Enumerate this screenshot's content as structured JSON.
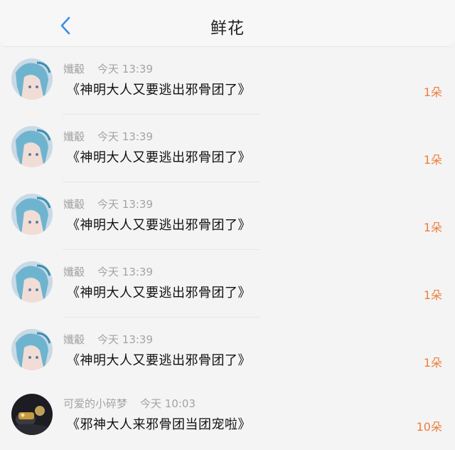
{
  "header": {
    "title": "鲜花"
  },
  "items": [
    {
      "user": "孅觳",
      "time": "今天 13:39",
      "message": "《神明大人又要逃出邪骨团了》",
      "count": "1朵",
      "avatar": "anime-girl"
    },
    {
      "user": "孅觳",
      "time": "今天 13:39",
      "message": "《神明大人又要逃出邪骨团了》",
      "count": "1朵",
      "avatar": "anime-girl"
    },
    {
      "user": "孅觳",
      "time": "今天 13:39",
      "message": "《神明大人又要逃出邪骨团了》",
      "count": "1朵",
      "avatar": "anime-girl"
    },
    {
      "user": "孅觳",
      "time": "今天 13:39",
      "message": "《神明大人又要逃出邪骨团了》",
      "count": "1朵",
      "avatar": "anime-girl"
    },
    {
      "user": "孅觳",
      "time": "今天 13:39",
      "message": "《神明大人又要逃出邪骨团了》",
      "count": "1朵",
      "avatar": "anime-girl"
    },
    {
      "user": "可爱的小碎梦",
      "time": "今天 10:03",
      "message": "《邪神大人来邪骨团当团宠啦》",
      "count": "10朵",
      "avatar": "dark-scene"
    }
  ],
  "colors": {
    "accent": "#3a8ee6",
    "count": "#ee7d3c"
  }
}
